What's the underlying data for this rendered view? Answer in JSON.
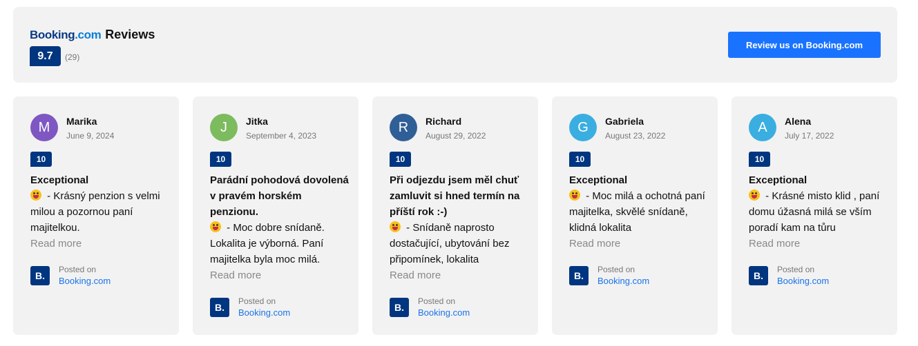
{
  "header": {
    "brand_part1": "Booking",
    "brand_part2": ".com",
    "title": "Reviews",
    "score": "9.7",
    "count": "(29)",
    "button_label": "Review us on Booking.com"
  },
  "posted_label": "Posted on",
  "posted_link": "Booking.com",
  "posted_icon_text": "B.",
  "read_more": "Read more",
  "colors": {
    "brand_blue": "#003580",
    "button_blue": "#1a73ff",
    "link_blue": "#1a73e8"
  },
  "reviews": [
    {
      "name": "Marika",
      "initial": "M",
      "avatar_color": "#7e57c2",
      "date": "June 9, 2024",
      "score": "10",
      "title": "Exceptional",
      "text": " - Krásný penzion s velmi milou a pozornou paní majitelkou."
    },
    {
      "name": "Jitka",
      "initial": "J",
      "avatar_color": "#7cbb5e",
      "date": "September 4, 2023",
      "score": "10",
      "title": "Parádní pohodová dovolená v pravém horském penzionu.",
      "text": " - Moc dobre snídaně. Lokalita je výborná. Paní majitelka byla moc milá."
    },
    {
      "name": "Richard",
      "initial": "R",
      "avatar_color": "#2f5f96",
      "date": "August 29, 2022",
      "score": "10",
      "title": "Při odjezdu jsem měl chuť zamluvit si hned termín na příští rok :-)",
      "text": " - Snídaně naprosto dostačující, ubytování bez připomínek, lokalita"
    },
    {
      "name": "Gabriela",
      "initial": "G",
      "avatar_color": "#3aaee0",
      "date": "August 23, 2022",
      "score": "10",
      "title": "Exceptional",
      "text": " - Moc milá a ochotná paní majitelka, skvělé snídaně, klidná lokalita"
    },
    {
      "name": "Alena",
      "initial": "A",
      "avatar_color": "#3aaee0",
      "date": "July 17, 2022",
      "score": "10",
      "title": "Exceptional",
      "text": " - Krásné misto klid , paní domu úžasná milá se vším poradí kam na tůru"
    }
  ]
}
